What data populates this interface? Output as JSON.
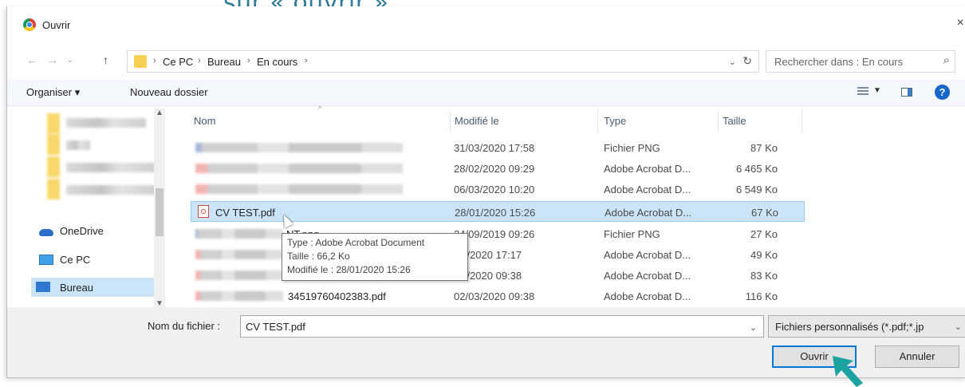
{
  "caption": "sur « ouvrir »",
  "window": {
    "title": "Ouvrir",
    "close_glyph": "×"
  },
  "nav": {
    "back": "←",
    "forward": "→",
    "up": "↑",
    "recent": "⌄"
  },
  "breadcrumb": [
    "Ce PC",
    "Bureau",
    "En cours"
  ],
  "breadcrumb_sep": "›",
  "search": {
    "placeholder": "Rechercher dans : En cours"
  },
  "toolbar": {
    "organize": "Organiser ▾",
    "new_folder": "Nouveau dossier",
    "help": "?"
  },
  "sidebar": {
    "onedrive": "OneDrive",
    "this_pc": "Ce PC",
    "desktop": "Bureau"
  },
  "columns": {
    "name": "Nom",
    "modified": "Modifié le",
    "type": "Type",
    "size": "Taille"
  },
  "files": [
    {
      "name_visible": "",
      "modified": "31/03/2020 17:58",
      "type": "Fichier PNG",
      "size": "87 Ko",
      "kind": "png"
    },
    {
      "name_visible": "",
      "modified": "28/02/2020 09:29",
      "type": "Adobe Acrobat D...",
      "size": "6 465 Ko",
      "kind": "pdf"
    },
    {
      "name_visible": "",
      "modified": "06/03/2020 10:20",
      "type": "Adobe Acrobat D...",
      "size": "6 549 Ko",
      "kind": "pdf"
    },
    {
      "name_visible": "CV TEST.pdf",
      "modified": "28/01/2020 15:26",
      "type": "Adobe Acrobat D...",
      "size": "67 Ko",
      "kind": "pdf",
      "selected": true
    },
    {
      "name_visible": "NT.png",
      "modified": "24/09/2019 09:26",
      "type": "Fichier PNG",
      "size": "27 Ko",
      "kind": "png"
    },
    {
      "name_visible": "",
      "modified": "01/2020 17:17",
      "type": "Adobe Acrobat D...",
      "size": "49 Ko",
      "kind": "pdf"
    },
    {
      "name_visible": "",
      "modified": "03/2020 09:38",
      "type": "Adobe Acrobat D...",
      "size": "83 Ko",
      "kind": "pdf"
    },
    {
      "name_visible": "34519760402383.pdf",
      "modified": "02/03/2020 09:38",
      "type": "Adobe Acrobat D...",
      "size": "116 Ko",
      "kind": "pdf"
    }
  ],
  "tooltip": {
    "type": "Type : Adobe Acrobat Document",
    "size": "Taille : 66,2 Ko",
    "modified": "Modifié le : 28/01/2020 15:26"
  },
  "footer": {
    "filename_label": "Nom du fichier :",
    "filename_value": "CV TEST.pdf",
    "filetype": "Fichiers personnalisés (*.pdf;*.jp",
    "open_label": "Ouvrir",
    "cancel_label": "Annuler"
  },
  "colors": {
    "accent": "#0078d7",
    "selection": "#cce4f7",
    "pointer_arrow": "#1aa3a0"
  }
}
